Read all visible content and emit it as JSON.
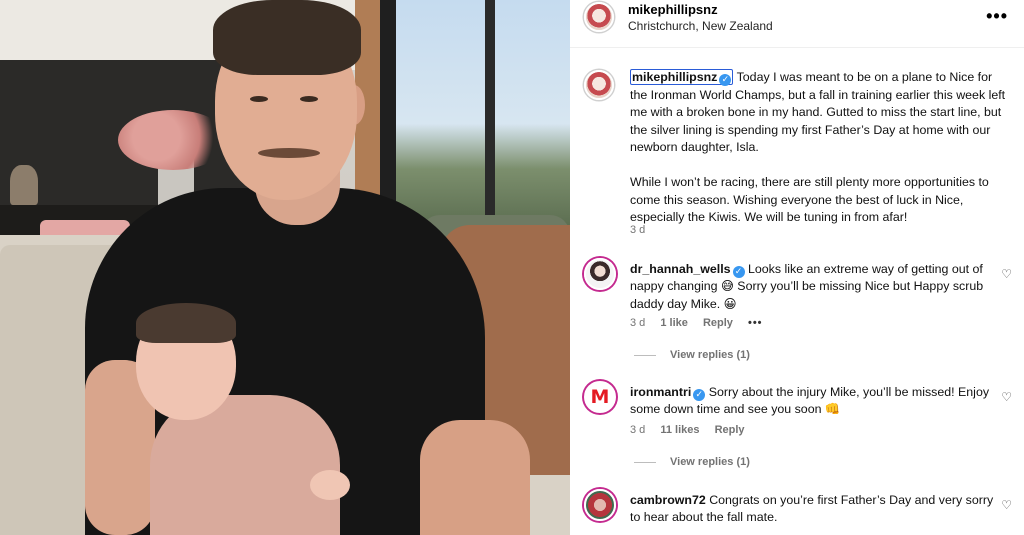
{
  "post": {
    "username": "mikephillipsnz",
    "location": "Christchurch, New Zealand",
    "more_icon": "more-horizontal-icon"
  },
  "caption": {
    "username": "mikephillipsnz",
    "paragraph1": "Today I was meant to be on a plane to Nice for the Ironman World Champs, but a fall in training earlier this week left me with a broken bone in my hand. Gutted to miss the start line, but the silver lining is spending my first Father’s Day at home with our newborn daughter, Isla.",
    "paragraph2": "While I won’t be racing, there are still plenty more opportunities to come this season. Wishing everyone the best of luck in Nice, especially the Kiwis. We will be tuning in from afar!",
    "time": "3 d"
  },
  "comments": [
    {
      "username": "dr_hannah_wells",
      "verified": true,
      "text": "Looks like an extreme way of getting out of nappy changing 😅 Sorry you’ll be missing Nice but Happy scrub daddy day Mike. 😀",
      "time": "3 d",
      "likes": "1 like",
      "reply": "Reply",
      "view_replies": "View replies (1)"
    },
    {
      "username": "ironmantri",
      "verified": true,
      "text": "Sorry about the injury Mike, you’ll be missed! Enjoy some down time and see you soon 👊",
      "time": "3 d",
      "likes": "11 likes",
      "reply": "Reply",
      "view_replies": "View replies (1)"
    },
    {
      "username": "cambrown72",
      "verified": false,
      "text": "Congrats on you’re first Father’s Day and very sorry to hear about the fall mate."
    }
  ],
  "icons": {
    "verified": "✓",
    "heart": "♡",
    "ironman_logo": "M",
    "more": "•••"
  }
}
